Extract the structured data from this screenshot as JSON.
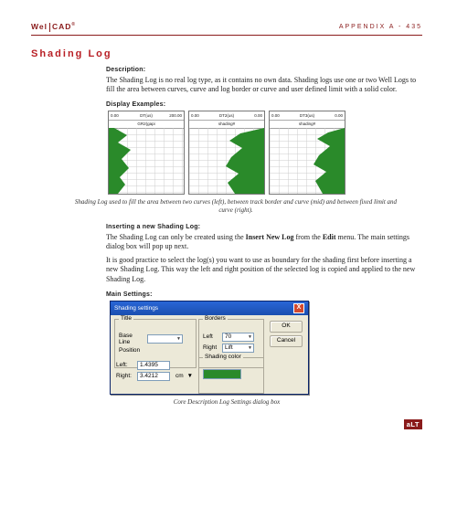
{
  "header": {
    "brand_l": "Wel",
    "brand_r": "CAD",
    "tm": "®",
    "appendix": "APPENDIX A - 435"
  },
  "title": "Shading Log",
  "sections": {
    "desc": {
      "h": "Description:",
      "p": "The Shading Log is no real log type, as it contains no own data. Shading logs use one or two Well Logs to fill the area between curves, curve and log border or curve and user defined limit with a solid color."
    },
    "ex": {
      "h": "Display Examples:",
      "cap": "Shading Log used to fill the area between two curves (left), between track border and curve (mid) and between fixed limit and curve (right)."
    },
    "ins": {
      "h": "Inserting a new Shading Log:",
      "p1a": "The Shading Log can only be created using the ",
      "p1b": "Insert New Log",
      "p1c": " from the ",
      "p1d": "Edit",
      "p1e": " menu. The main settings dialog box will pop up next.",
      "p2": "It is good practice to select the log(s) you want to use as boundary for the shading first before inserting a new Shading Log. This way the left and right position of the selected log is copied and applied to the new Shading Log."
    },
    "ms": {
      "h": "Main Settings:",
      "cap": "Core Description Log Settings dialog box"
    }
  },
  "tracks": {
    "t1": {
      "l1l": "0.00",
      "l1m": "DT(us)",
      "l1r": "200.00",
      "l2l": "",
      "l2m": "GR2(gapi",
      "l2r": "",
      "l3l": "",
      "l3m": "shading",
      "l3r": ""
    },
    "t2": {
      "l1l": "0.00",
      "l1m": "DT2(us)",
      "l1r": "0.00",
      "l2l": "",
      "l2m": "shading#",
      "l2r": ""
    },
    "t3": {
      "l1l": "0.00",
      "l1m": "DT3(us)",
      "l1r": "0.00",
      "l2l": "",
      "l2m": "shading#",
      "l2r": ""
    }
  },
  "dialog": {
    "title": "Shading settings",
    "close": "X",
    "title_group": "Title",
    "baseline_lbl": "Base Line",
    "baseline_val": "",
    "pos_lbl": "Position",
    "left_lbl": "Left:",
    "left_val": "1.4395",
    "right_lbl": "Right:",
    "right_val": "3.4212",
    "unit": "cm",
    "borders_group": "Borders",
    "b_left_lbl": "Left",
    "b_left_val": "70",
    "b_right_lbl": "Right",
    "b_right_val": "Lift",
    "shade_lbl": "Shading color",
    "ok": "OK",
    "cancel": "Cancel"
  },
  "footer_logo": "aLT"
}
